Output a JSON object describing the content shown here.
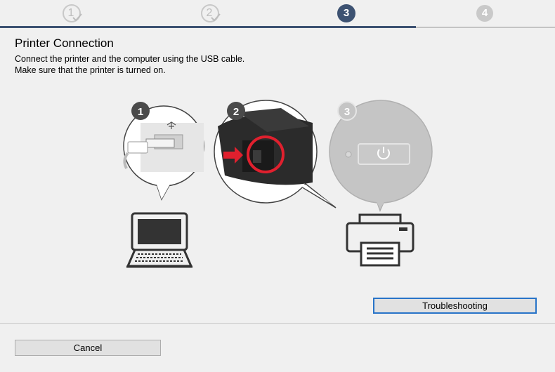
{
  "steps": [
    {
      "number": "1",
      "state": "done"
    },
    {
      "number": "2",
      "state": "done"
    },
    {
      "number": "3",
      "state": "current"
    },
    {
      "number": "4",
      "state": "future"
    }
  ],
  "page": {
    "title": "Printer Connection",
    "instructions": [
      "Connect the printer and the computer using the USB cable.",
      "Make sure that the printer is turned on."
    ]
  },
  "illustration": {
    "callouts": [
      "1",
      "2",
      "3"
    ],
    "icons": [
      "usb-cable-icon",
      "laptop-icon",
      "printer-port-icon",
      "power-button-icon",
      "printer-icon"
    ]
  },
  "buttons": {
    "troubleshooting": "Troubleshooting",
    "cancel": "Cancel"
  },
  "colors": {
    "accent": "#3d5272",
    "focus_border": "#2874c8",
    "highlight_red": "#e0202e"
  }
}
